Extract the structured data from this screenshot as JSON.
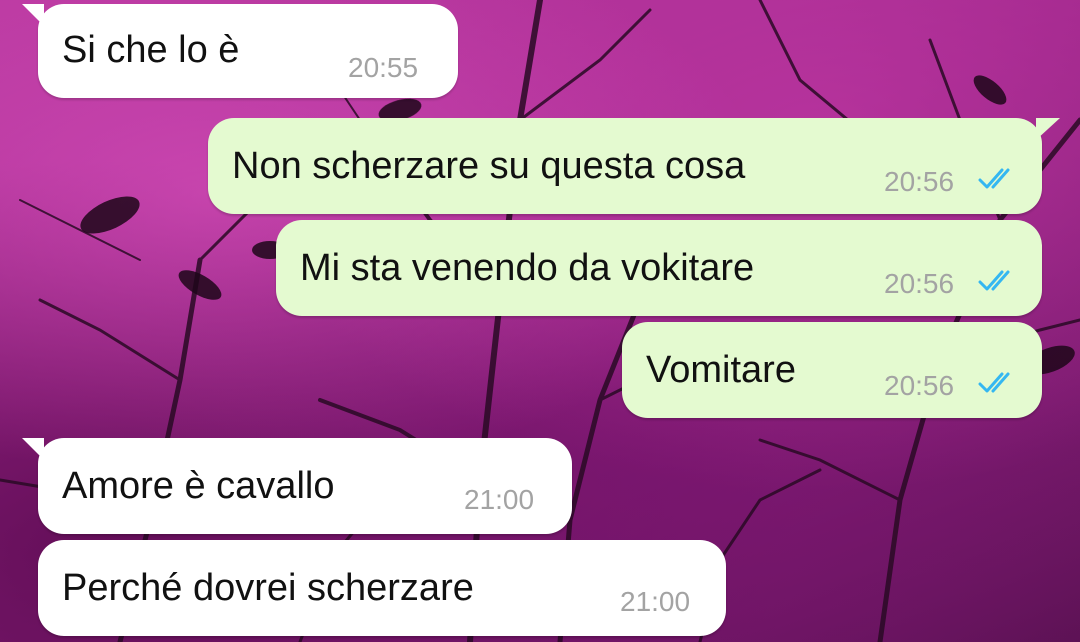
{
  "chat": {
    "messages": [
      {
        "direction": "incoming",
        "text": "Si che lo è",
        "time": "20:55"
      },
      {
        "direction": "outgoing",
        "text": "Non scherzare su questa cosa",
        "time": "20:56",
        "status": "read"
      },
      {
        "direction": "outgoing",
        "text": "Mi sta venendo da vokitare",
        "time": "20:56",
        "status": "read"
      },
      {
        "direction": "outgoing",
        "text": "Vomitare",
        "time": "20:56",
        "status": "read"
      },
      {
        "direction": "incoming",
        "text": "Amore è cavallo",
        "time": "21:00"
      },
      {
        "direction": "incoming",
        "text": "Perché dovrei scherzare",
        "time": "21:00"
      }
    ]
  },
  "colors": {
    "incoming_bubble": "#ffffff",
    "outgoing_bubble": "#e4fad0",
    "read_ticks": "#34b7f1",
    "timestamp": "#a3a3a3",
    "wallpaper_base": "#9a2a86"
  },
  "icons": {
    "read_receipt": "double-check-icon"
  }
}
